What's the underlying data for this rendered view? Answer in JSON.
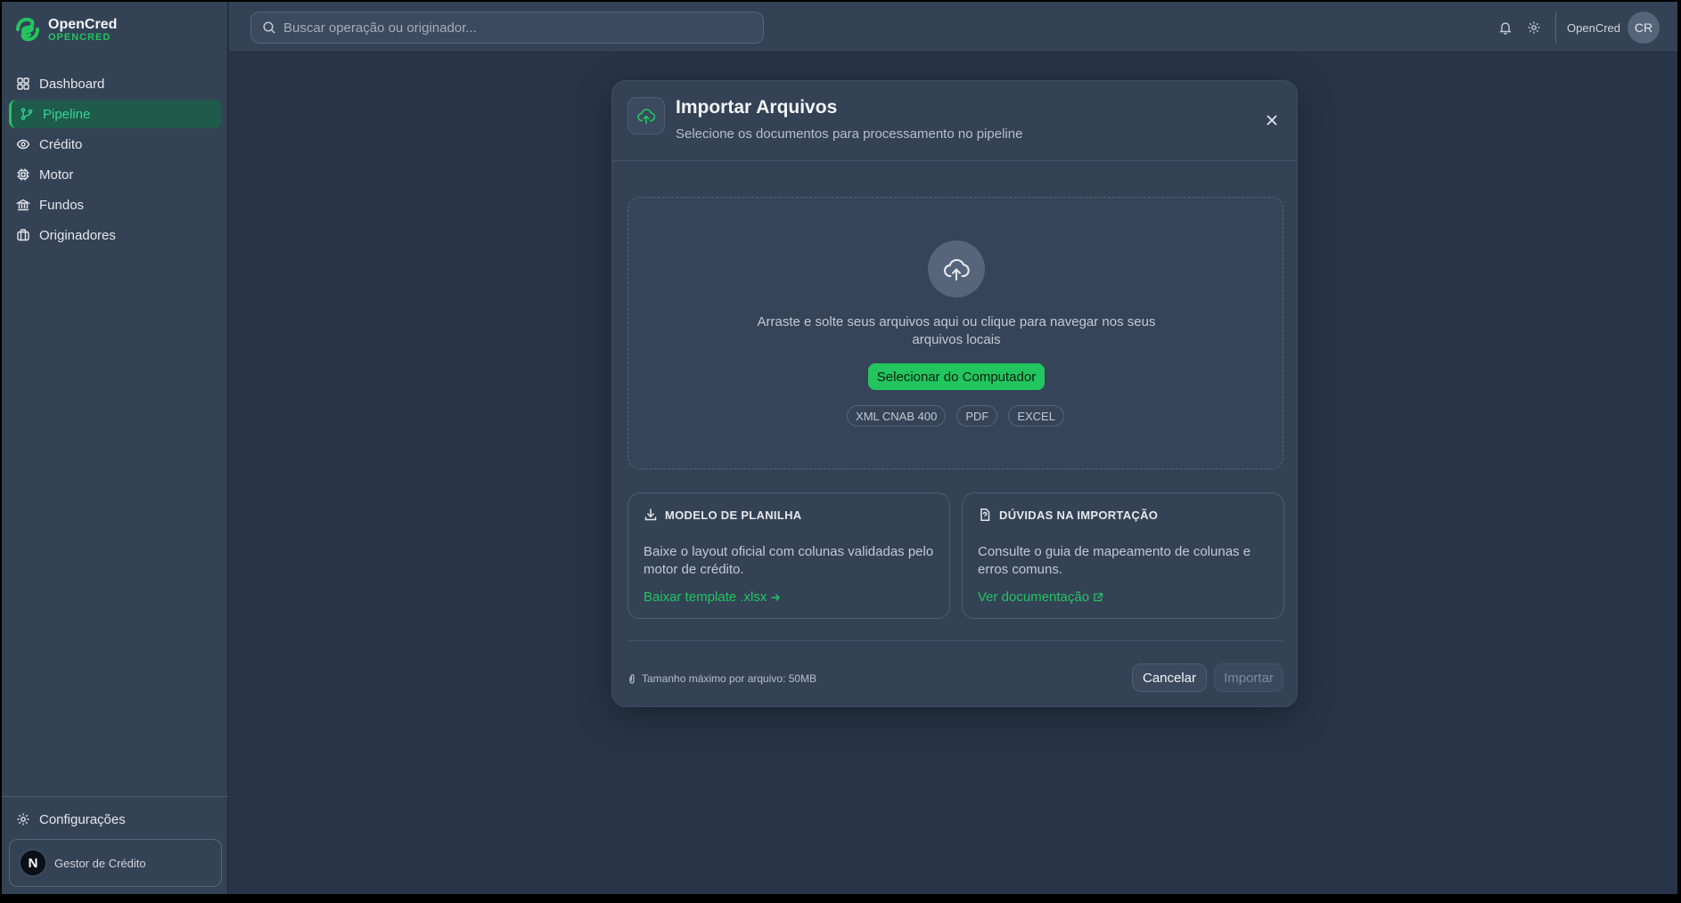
{
  "brand": {
    "name": "OpenCred",
    "subtitle": "OPENCRED",
    "accent": "#22c55e"
  },
  "sidebar": {
    "items": [
      {
        "label": "Dashboard",
        "icon": "grid-icon"
      },
      {
        "label": "Pipeline",
        "icon": "git-branch-icon",
        "active": true
      },
      {
        "label": "Crédito",
        "icon": "eye-icon"
      },
      {
        "label": "Motor",
        "icon": "cpu-icon"
      },
      {
        "label": "Fundos",
        "icon": "bank-icon"
      },
      {
        "label": "Originadores",
        "icon": "briefcase-icon"
      }
    ],
    "settings_label": "Configurações",
    "user": {
      "initial": "N",
      "role": "Gestor de Crédito"
    }
  },
  "topbar": {
    "search_placeholder": "Buscar operação ou originador...",
    "user_name": "OpenCred",
    "user_initials": "CR"
  },
  "modal": {
    "title": "Importar Arquivos",
    "subtitle": "Selecione os documentos para processamento no pipeline",
    "dropzone": {
      "text": "Arraste e solte seus arquivos aqui ou clique para navegar nos seus arquivos locais",
      "button_label": "Selecionar do Computador",
      "formats": [
        "XML CNAB 400",
        "PDF",
        "EXCEL"
      ]
    },
    "template_card": {
      "title": "MODELO DE PLANILHA",
      "text": "Baixe o layout oficial com colunas validadas pelo motor de crédito.",
      "link": "Baixar template .xlsx"
    },
    "help_card": {
      "title": "DÚVIDAS NA IMPORTAÇÃO",
      "text": "Consulte o guia de mapeamento de colunas e erros comuns.",
      "link": "Ver documentação"
    },
    "footer_note": "Tamanho máximo por arquivo: 50MB",
    "cancel_label": "Cancelar",
    "import_label": "Importar"
  }
}
